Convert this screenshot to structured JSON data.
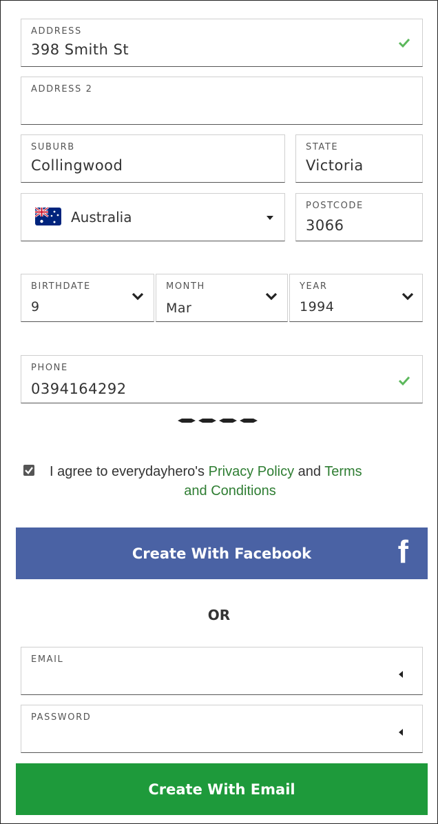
{
  "address": {
    "label": "ADDRESS",
    "value": "398 Smith St"
  },
  "address2": {
    "label": "ADDRESS 2",
    "value": ""
  },
  "suburb": {
    "label": "SUBURB",
    "value": "Collingwood"
  },
  "state": {
    "label": "STATE",
    "value": "Victoria"
  },
  "country": {
    "value": "Australia",
    "flag_icon": "australia-flag-icon"
  },
  "postcode": {
    "label": "POSTCODE",
    "value": "3066"
  },
  "birthdate": {
    "label": "BIRTHDATE",
    "value": "9"
  },
  "month": {
    "label": "MONTH",
    "value": "Mar"
  },
  "year": {
    "label": "YEAR",
    "value": "1994"
  },
  "phone": {
    "label": "PHONE",
    "value": "0394164292"
  },
  "agreement": {
    "checked": true,
    "prefix": "I agree to everydayhero's ",
    "privacy_link": "Privacy Policy",
    "and1": " and ",
    "terms_link_part1": "Terms",
    "terms_link_part2": "and Conditions"
  },
  "facebook_button": {
    "label": "Create With Facebook",
    "icon": "f"
  },
  "separator": "OR",
  "email": {
    "label": "EMAIL",
    "value": ""
  },
  "password": {
    "label": "PASSWORD",
    "value": ""
  },
  "email_button": {
    "label": "Create With Email"
  },
  "colors": {
    "facebook": "#4a62a4",
    "email": "#1e9a3b",
    "link": "#2e7d32",
    "check": "#5cb85c"
  }
}
